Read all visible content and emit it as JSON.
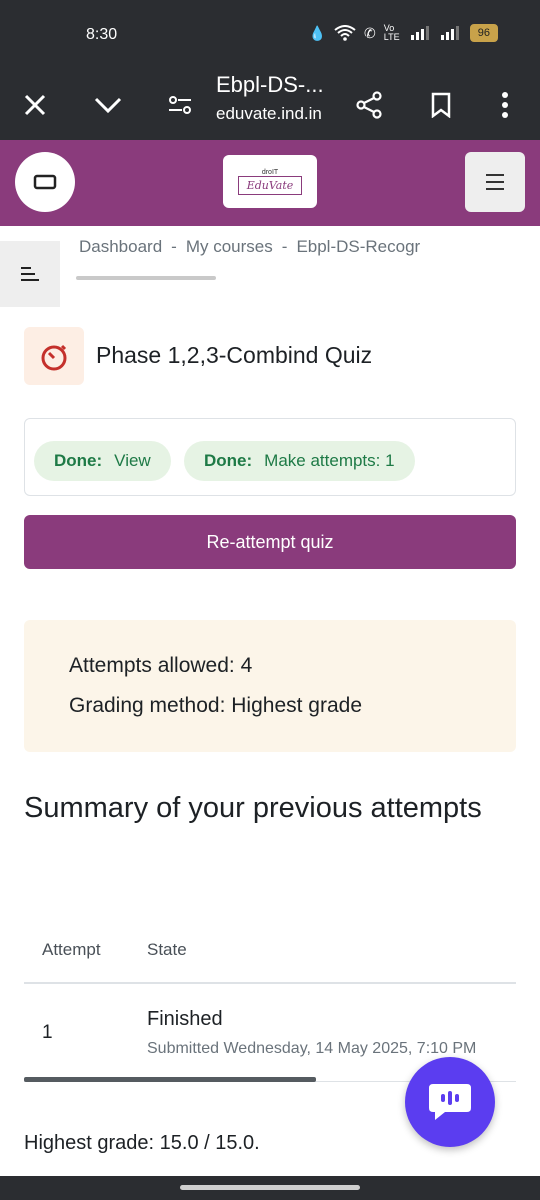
{
  "status_bar": {
    "time": "8:30",
    "network_label": "Vo LTE",
    "battery": "96"
  },
  "browser": {
    "title": "Ebpl-DS-...",
    "url": "eduvate.ind.in"
  },
  "app_bar": {
    "logo_top": "droIT",
    "logo_text": "EduVate",
    "brand_color": "#8a3b7c"
  },
  "breadcrumb": {
    "items": [
      "Dashboard",
      "My courses",
      "Ebpl-DS-Recogr"
    ],
    "separator": "-"
  },
  "quiz": {
    "title": "Phase 1,2,3-Combind Quiz",
    "icon": "stopwatch-icon"
  },
  "completion": {
    "items": [
      {
        "status": "Done:",
        "label": "View"
      },
      {
        "status": "Done:",
        "label": "Make attempts: 1"
      }
    ]
  },
  "reattempt_button": "Re-attempt quiz",
  "info": {
    "attempts_allowed": "Attempts allowed: 4",
    "grading_method": "Grading method: Highest grade"
  },
  "summary": {
    "heading": "Summary of your previous attempts",
    "columns": [
      "Attempt",
      "State"
    ],
    "rows": [
      {
        "attempt": "1",
        "state": "Finished",
        "submitted": "Submitted Wednesday, 14 May 2025, 7:10 PM"
      }
    ]
  },
  "highest_grade": "Highest grade: 15.0 / 15.0."
}
